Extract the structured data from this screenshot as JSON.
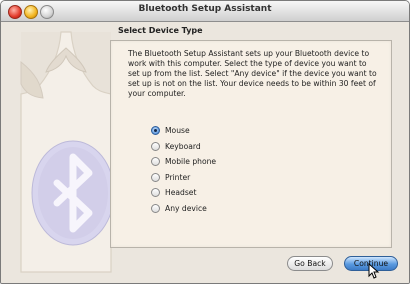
{
  "window": {
    "title": "Bluetooth Setup Assistant"
  },
  "content": {
    "heading": "Select Device Type",
    "description": "The Bluetooth Setup Assistant sets up your Bluetooth device to work with this computer. Select the type of device you want to set up from the list. Select \"Any device\" if the device you want to set up is not on the list. Your device needs to be within 30 feet of your computer.",
    "device_types": [
      {
        "label": "Mouse",
        "selected": true
      },
      {
        "label": "Keyboard",
        "selected": false
      },
      {
        "label": "Mobile phone",
        "selected": false
      },
      {
        "label": "Printer",
        "selected": false
      },
      {
        "label": "Headset",
        "selected": false
      },
      {
        "label": "Any device",
        "selected": false
      }
    ]
  },
  "buttons": {
    "back_label": "Go Back",
    "continue_label": "Continue"
  }
}
